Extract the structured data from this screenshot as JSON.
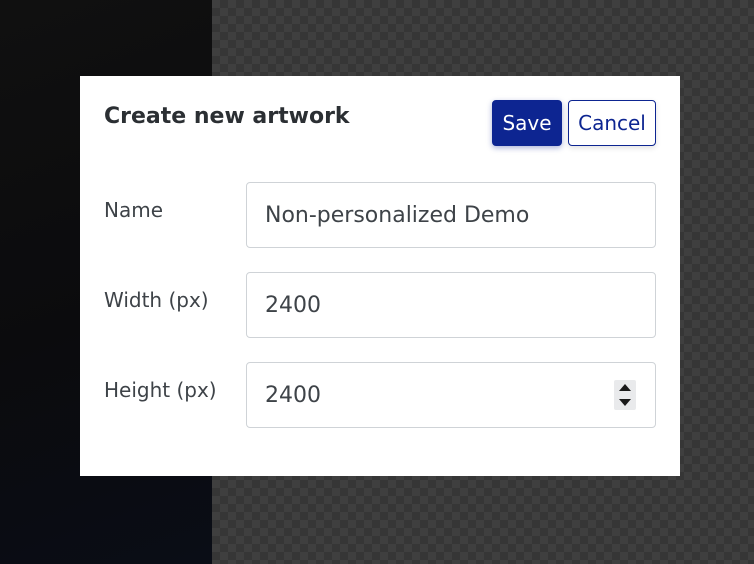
{
  "dialog": {
    "title": "Create new artwork",
    "save_label": "Save",
    "cancel_label": "Cancel"
  },
  "fields": {
    "name": {
      "label": "Name",
      "value": "Non-personalized Demo"
    },
    "width": {
      "label": "Width (px)",
      "value": "2400"
    },
    "height": {
      "label": "Height (px)",
      "value": "2400"
    }
  },
  "colors": {
    "primary": "#0d2591",
    "text": "#3e4348",
    "border": "#cfd3d7"
  },
  "icons": {
    "spinner_up": "chevron-up-icon",
    "spinner_down": "chevron-down-icon"
  }
}
